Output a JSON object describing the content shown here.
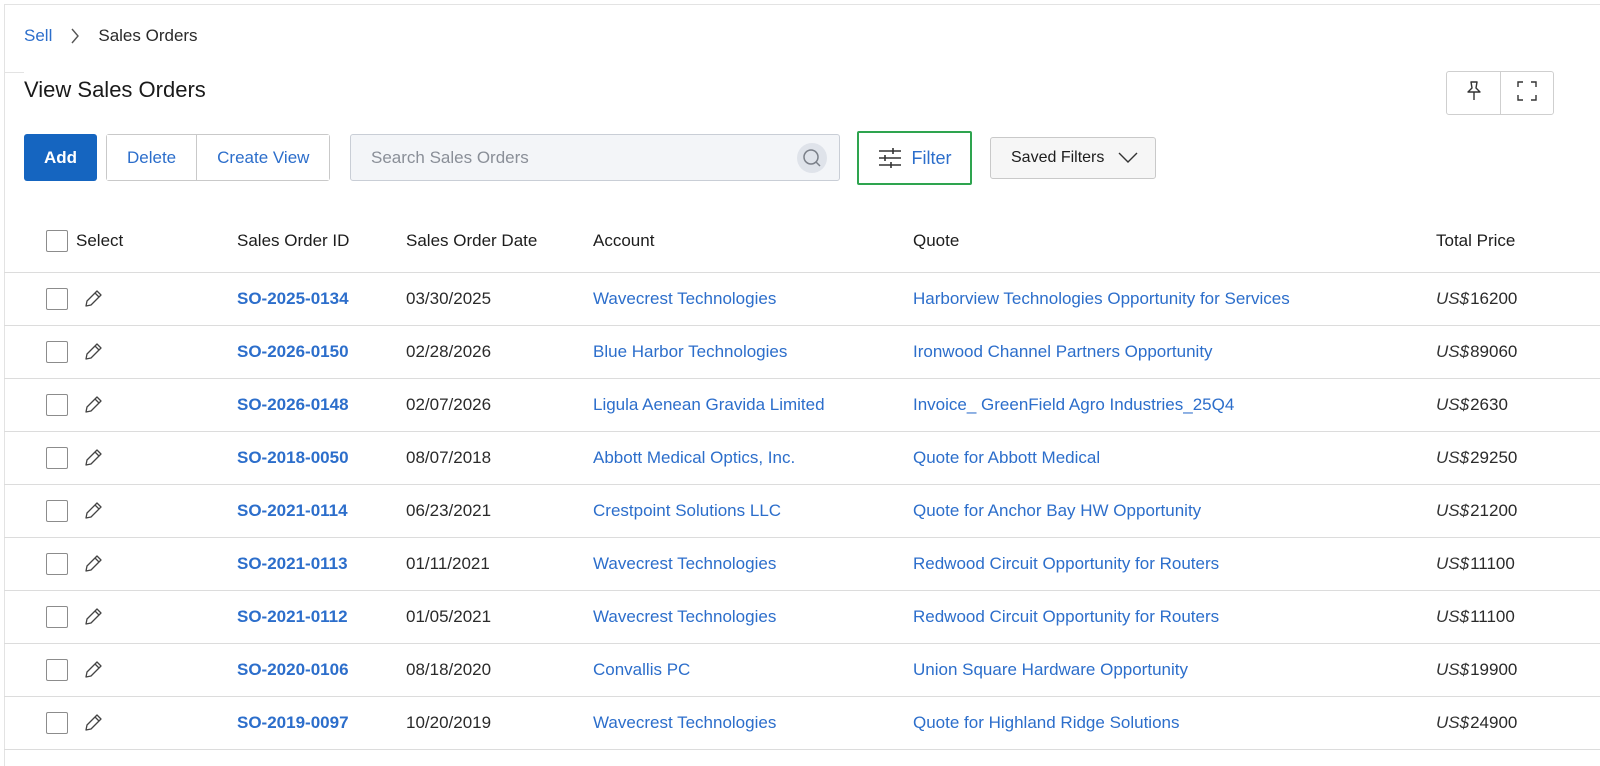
{
  "breadcrumb": {
    "parent": "Sell",
    "current": "Sales Orders"
  },
  "page": {
    "title": "View Sales Orders"
  },
  "toolbar": {
    "add_label": "Add",
    "delete_label": "Delete",
    "create_view_label": "Create View",
    "search_placeholder": "Search Sales Orders",
    "filter_label": "Filter",
    "saved_filters_label": "Saved Filters"
  },
  "table": {
    "columns": {
      "select": "Select",
      "id": "Sales Order ID",
      "date": "Sales Order Date",
      "account": "Account",
      "quote": "Quote",
      "price": "Total Price"
    },
    "currency": "US$",
    "rows": [
      {
        "id": "SO-2025-0134",
        "date": "03/30/2025",
        "account": "Wavecrest Technologies",
        "quote": "Harborview Technologies Opportunity for Services",
        "price": "16200"
      },
      {
        "id": "SO-2026-0150",
        "date": "02/28/2026",
        "account": "Blue Harbor Technologies",
        "quote": "Ironwood Channel Partners Opportunity",
        "price": "89060"
      },
      {
        "id": "SO-2026-0148",
        "date": "02/07/2026",
        "account": "Ligula Aenean Gravida Limited",
        "quote": "Invoice_ GreenField Agro Industries_25Q4",
        "price": "2630"
      },
      {
        "id": "SO-2018-0050",
        "date": "08/07/2018",
        "account": "Abbott Medical Optics, Inc.",
        "quote": "Quote for Abbott Medical",
        "price": "29250"
      },
      {
        "id": "SO-2021-0114",
        "date": "06/23/2021",
        "account": "Crestpoint Solutions LLC",
        "quote": "Quote for Anchor Bay HW Opportunity",
        "price": "21200"
      },
      {
        "id": "SO-2021-0113",
        "date": "01/11/2021",
        "account": "Wavecrest Technologies",
        "quote": "Redwood Circuit Opportunity for Routers",
        "price": "11100"
      },
      {
        "id": "SO-2021-0112",
        "date": "01/05/2021",
        "account": "Wavecrest Technologies",
        "quote": "Redwood Circuit Opportunity for Routers",
        "price": "11100"
      },
      {
        "id": "SO-2020-0106",
        "date": "08/18/2020",
        "account": "Convallis PC",
        "quote": "Union Square Hardware Opportunity",
        "price": "19900"
      },
      {
        "id": "SO-2019-0097",
        "date": "10/20/2019",
        "account": "Wavecrest Technologies",
        "quote": "Quote for Highland Ridge Solutions",
        "price": "24900"
      }
    ]
  },
  "colors": {
    "accent": "#1565c0",
    "link": "#2c6ecb",
    "filter_outline": "#2ea44f"
  },
  "icons": [
    "chevron-right-icon",
    "pin-icon",
    "fullscreen-icon",
    "search-icon",
    "sliders-icon",
    "chevron-down-icon",
    "pencil-icon"
  ]
}
